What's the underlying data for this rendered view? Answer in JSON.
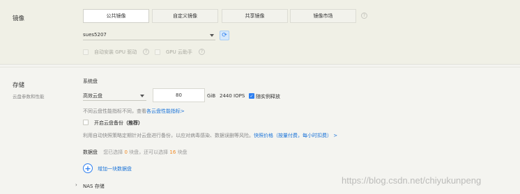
{
  "image_section": {
    "title": "镜像",
    "tabs": [
      {
        "label": "公共镜像",
        "active": true
      },
      {
        "label": "自定义镜像",
        "active": false
      },
      {
        "label": "共享镜像",
        "active": false
      },
      {
        "label": "镜像市场",
        "active": false
      }
    ],
    "os_select": {
      "value": "sues5207"
    },
    "options": [
      {
        "label": "自动安装 GPU 驱动"
      },
      {
        "label": "GPU 云助手"
      }
    ]
  },
  "storage_section": {
    "title": "存储",
    "subtitle": "云盘参数和性能",
    "system_disk": {
      "label": "系统盘",
      "type_value": "高效云盘",
      "size_value": "80",
      "unit": "GiB",
      "iops": "2440 IOPS",
      "release_label": "随实例释放",
      "perf_note": "不同云盘性能指标不同，查看",
      "perf_link": "各云盘性能指标>",
      "backup_label": "开启云盘备份",
      "backup_recommend": "（推荐）",
      "backup_desc": "利用自动快照策略定期针对云盘进行备份，以应对病毒感染、数据误删等风险。",
      "backup_link": "快照价格（按量付费，每小时扣费） >"
    },
    "data_disk": {
      "label": "数据盘",
      "count_text_1": "您已选择",
      "selected_count": "0",
      "count_text_2": "块盘，还可以选择",
      "remaining_count": "16",
      "count_text_3": "块盘",
      "add_label": "增加一块数据盘"
    },
    "nas": {
      "label": "NAS 存储"
    }
  },
  "watermark": "https://blog.csdn.net/chiyukunpeng",
  "colors": {
    "accent": "#2d7ff0",
    "link": "#1a73d8",
    "orange": "#f08a24"
  }
}
